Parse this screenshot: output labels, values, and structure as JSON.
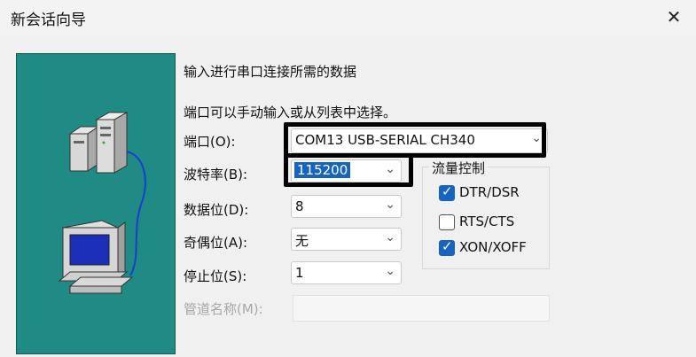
{
  "window": {
    "title": "新会话向导",
    "close_glyph": "✕"
  },
  "intro": {
    "line1": "输入进行串口连接所需的数据",
    "line2": "端口可以手动输入或从列表中选择。"
  },
  "fields": {
    "port": {
      "label": "端口(O):",
      "value": "COM13 USB-SERIAL CH340"
    },
    "baud": {
      "label": "波特率(B):",
      "value": "115200"
    },
    "databits": {
      "label": "数据位(D):",
      "value": "8"
    },
    "parity": {
      "label": "奇偶位(A):",
      "value": "无"
    },
    "stopbits": {
      "label": "停止位(S):",
      "value": "1"
    },
    "pipe": {
      "label": "管道名称(M):",
      "value": ""
    }
  },
  "flow_control": {
    "title": "流量控制",
    "options": [
      {
        "label": "DTR/DSR",
        "checked": true
      },
      {
        "label": "RTS/CTS",
        "checked": false
      },
      {
        "label": "XON/XOFF",
        "checked": true
      }
    ]
  },
  "glyphs": {
    "chevron": "⌄",
    "check": "✓"
  },
  "colors": {
    "art_bg": "#1f8b84",
    "accent": "#1565c0",
    "highlight_border": "#000000"
  }
}
